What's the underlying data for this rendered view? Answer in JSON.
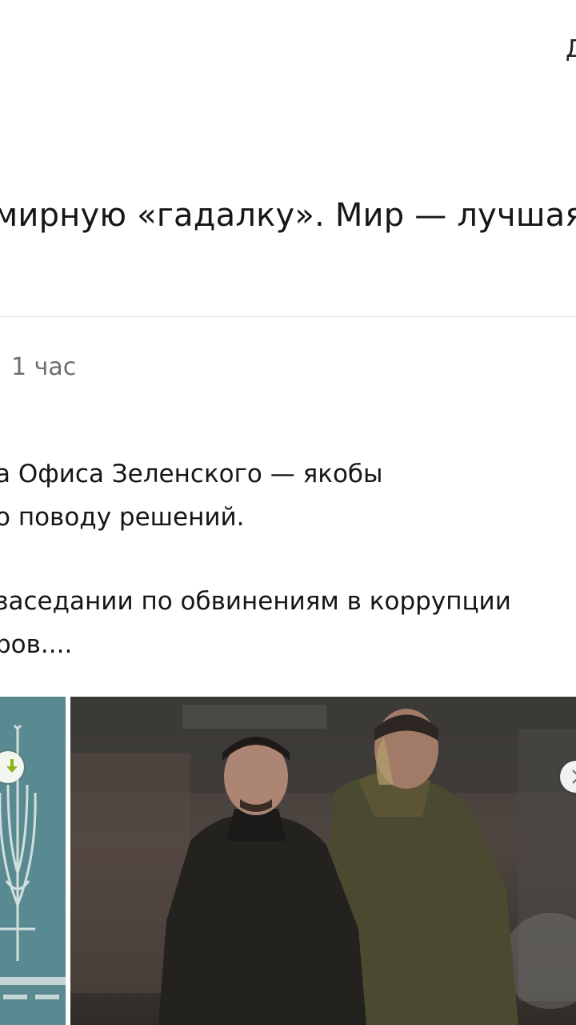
{
  "header": {
    "top_glyph": "Д"
  },
  "article": {
    "headline_fragment": "мирную «гадалку». Мир — лучшая"
  },
  "news_item": {
    "timestamp": "1 час",
    "summary_lines": [
      "а Офиса Зеленского — якобы",
      "о поводу решений.",
      "заседании по обвинениям в коррупции",
      "ров...."
    ]
  },
  "gallery": {
    "images": [
      {
        "icon": "ukraine-trident-emblem"
      },
      {
        "icon": "photo-zelensky-yermak"
      }
    ],
    "badge_icon": "download-arrow-icon",
    "next_icon": "chevron-right-icon"
  },
  "colors": {
    "text": "#161616",
    "muted": "#6f6f6f",
    "divider": "#eadfd9",
    "badge_arrow": "#8ab31a"
  }
}
